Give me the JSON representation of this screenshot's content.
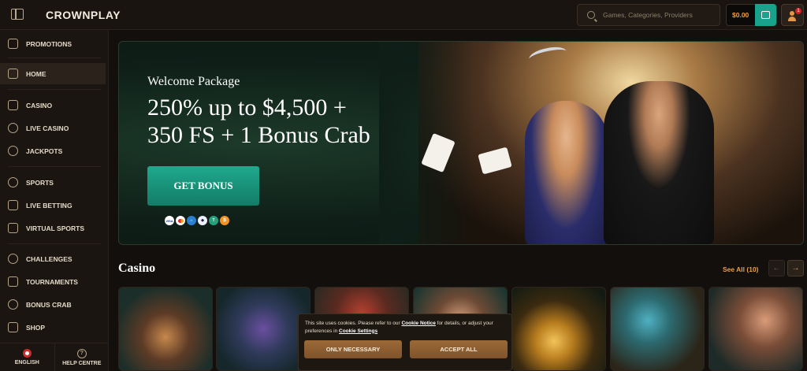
{
  "header": {
    "logo": "CROWNPLAY",
    "search_placeholder": "Games, Categories, Providers",
    "balance": "$0.00",
    "notification_count": "1"
  },
  "sidebar": {
    "items": [
      {
        "label": "PROMOTIONS",
        "icon": "gift-icon"
      },
      {
        "label": "HOME",
        "icon": "home-icon"
      },
      {
        "label": "CASINO",
        "icon": "slot-machine-icon"
      },
      {
        "label": "LIVE CASINO",
        "icon": "spade-icon"
      },
      {
        "label": "JACKPOTS",
        "icon": "clover-icon"
      },
      {
        "label": "SPORTS",
        "icon": "soccer-ball-icon"
      },
      {
        "label": "LIVE BETTING",
        "icon": "live-betting-icon"
      },
      {
        "label": "VIRTUAL SPORTS",
        "icon": "gamepad-icon"
      },
      {
        "label": "CHALLENGES",
        "icon": "medal-icon"
      },
      {
        "label": "TOURNAMENTS",
        "icon": "trophy-icon"
      },
      {
        "label": "BONUS CRAB",
        "icon": "crab-claw-icon"
      },
      {
        "label": "SHOP",
        "icon": "shop-bag-icon"
      }
    ],
    "active": "HOME",
    "footer": {
      "language": "ENGLISH",
      "help": "HELP CENTRE"
    }
  },
  "banner": {
    "subtitle": "Welcome Package",
    "headline_line1": "250% up to $4,500 +",
    "headline_line2": "350 FS + 1 Bonus Crab",
    "cta": "GET BONUS",
    "payment_icons": [
      "VISA",
      "mastercard",
      "bank",
      "ethereum",
      "tether",
      "bitcoin"
    ]
  },
  "casino_section": {
    "title": "Casino",
    "see_all": "See All (10)",
    "tile_count": 7
  },
  "cookie_banner": {
    "text_1": "This site uses cookies. Please refer to our ",
    "link_1": "Cookie Notice",
    "text_2": " for details, or adjust your preferences in ",
    "link_2": "Cookie Settings",
    "only_necessary": "ONLY NECESSARY",
    "accept_all": "ACCEPT ALL"
  },
  "colors": {
    "accent_orange": "#e8a04a",
    "cta_teal": "#19a28c",
    "background": "#120f0c"
  }
}
